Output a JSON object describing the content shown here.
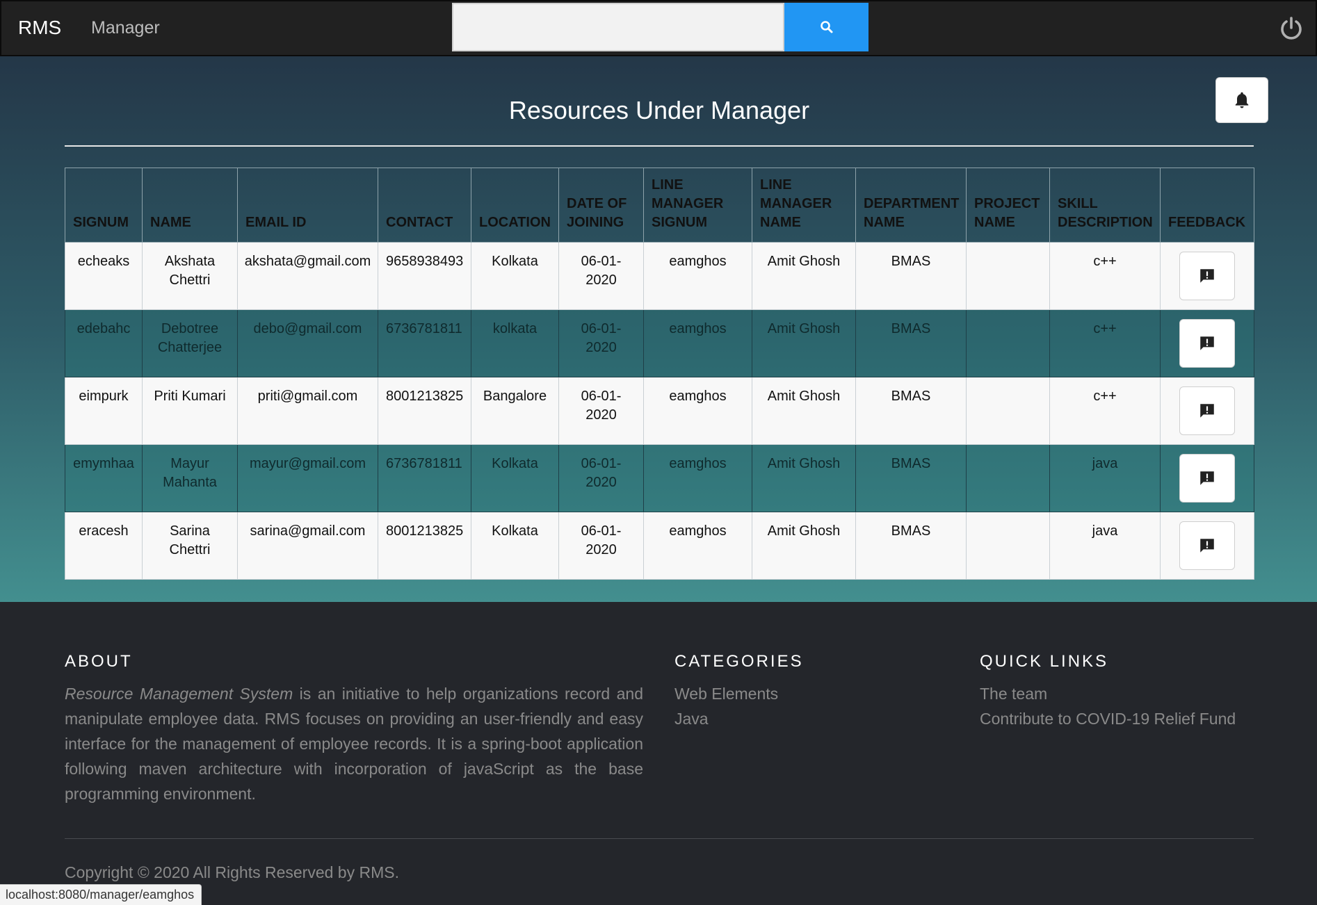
{
  "navbar": {
    "brand": "RMS",
    "role_link": "Manager",
    "search_placeholder": "",
    "search_icon": "search-icon",
    "power_icon": "power-icon"
  },
  "main": {
    "title": "Resources Under Manager",
    "bell_icon": "bell-icon"
  },
  "table": {
    "headers": {
      "signum": "SIGNUM",
      "name": "NAME",
      "email": "EMAIL ID",
      "contact": "CONTACT",
      "location": "LOCATION",
      "doj_1": "DATE OF",
      "doj_2": "JOINING",
      "lms_1": "LINE",
      "lms_2": "MANAGER",
      "lms_3": "SIGNUM",
      "lmn_1": "LINE",
      "lmn_2": "MANAGER",
      "lmn_3": "NAME",
      "dept_1": "DEPARTMENT",
      "dept_2": "NAME",
      "proj_1": "PROJECT",
      "proj_2": "NAME",
      "skill_1": "SKILL",
      "skill_2": "DESCRIPTION",
      "feedback": "FEEDBACK"
    },
    "rows": [
      {
        "signum": "echeaks",
        "name_1": "Akshata",
        "name_2": "Chettri",
        "email": "akshata@gmail.com",
        "contact": "9658938493",
        "location": "Kolkata",
        "doj_1": "06-01-",
        "doj_2": "2020",
        "lm_signum": "eamghos",
        "lm_name": "Amit Ghosh",
        "dept": "BMAS",
        "project": "",
        "skill": "c++"
      },
      {
        "signum": "edebahc",
        "name_1": "Debotree",
        "name_2": "Chatterjee",
        "email": "debo@gmail.com",
        "contact": "6736781811",
        "location": "kolkata",
        "doj_1": "06-01-",
        "doj_2": "2020",
        "lm_signum": "eamghos",
        "lm_name": "Amit Ghosh",
        "dept": "BMAS",
        "project": "",
        "skill": "c++"
      },
      {
        "signum": "eimpurk",
        "name_1": "Priti Kumari",
        "name_2": "",
        "email": "priti@gmail.com",
        "contact": "8001213825",
        "location": "Bangalore",
        "doj_1": "06-01-",
        "doj_2": "2020",
        "lm_signum": "eamghos",
        "lm_name": "Amit Ghosh",
        "dept": "BMAS",
        "project": "",
        "skill": "c++"
      },
      {
        "signum": "emymhaa",
        "name_1": "Mayur",
        "name_2": "Mahanta",
        "email": "mayur@gmail.com",
        "contact": "6736781811",
        "location": "Kolkata",
        "doj_1": "06-01-",
        "doj_2": "2020",
        "lm_signum": "eamghos",
        "lm_name": "Amit Ghosh",
        "dept": "BMAS",
        "project": "",
        "skill": "java"
      },
      {
        "signum": "eracesh",
        "name_1": "Sarina",
        "name_2": "Chettri",
        "email": "sarina@gmail.com",
        "contact": "8001213825",
        "location": "Kolkata",
        "doj_1": "06-01-",
        "doj_2": "2020",
        "lm_signum": "eamghos",
        "lm_name": "Amit Ghosh",
        "dept": "BMAS",
        "project": "",
        "skill": "java"
      }
    ],
    "feedback_icon": "feedback-icon"
  },
  "footer": {
    "about_heading": "ABOUT",
    "about_italic": "Resource Management System",
    "about_rest": " is an initiative to help organizations record and manipulate employee data. RMS focuses on providing an user-friendly and easy interface for the management of employee records. It is a spring-boot application following maven architecture with incorporation of javaScript as the base programming environment.",
    "categories_heading": "CATEGORIES",
    "categories": [
      "Web Elements",
      "Java"
    ],
    "quick_links_heading": "QUICK LINKS",
    "quick_links": [
      "The team",
      "Contribute to COVID-19 Relief Fund"
    ],
    "copyright": "Copyright © 2020 All Rights Reserved by RMS."
  },
  "status_bar": {
    "url": "localhost:8080/manager/eamghos"
  },
  "colors": {
    "search_button": "#2196f3",
    "navbar": "#212121",
    "footer": "#24262b"
  }
}
